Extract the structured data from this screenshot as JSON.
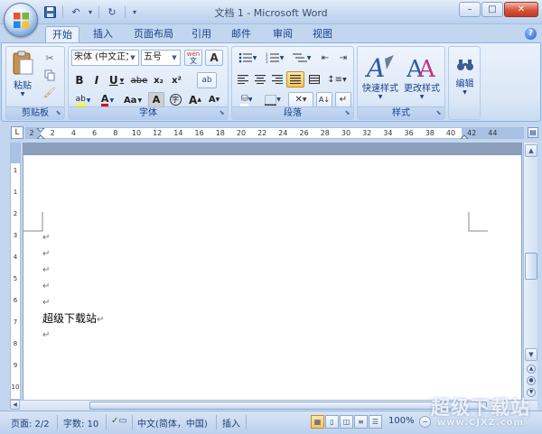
{
  "window": {
    "title": "文档 1 - Microsoft Word",
    "min_glyph": "–",
    "max_glyph": "□",
    "close_glyph": "✕"
  },
  "qat": {
    "undo_glyph": "↶",
    "redo_glyph": "↻",
    "dropdown_glyph": "▾"
  },
  "tabs": [
    {
      "label": "开始",
      "active": true
    },
    {
      "label": "插入"
    },
    {
      "label": "页面布局"
    },
    {
      "label": "引用"
    },
    {
      "label": "邮件"
    },
    {
      "label": "审阅"
    },
    {
      "label": "视图"
    }
  ],
  "help_glyph": "?",
  "ribbon": {
    "clipboard": {
      "label": "剪贴板",
      "paste_label": "粘贴"
    },
    "font": {
      "label": "字体",
      "font_name": "宋体 (中文正文)",
      "font_size": "五号",
      "wen_glyph": "wén",
      "bold": "B",
      "italic": "I",
      "underline": "U",
      "strike": "abe",
      "subscript": "x₂",
      "superscript": "x²",
      "aa": "Aa",
      "a_box": "A",
      "a_circle": "字",
      "grow": "A",
      "shrink": "A"
    },
    "paragraph": {
      "label": "段落"
    },
    "styles": {
      "label": "样式",
      "quick_styles": "快速样式",
      "change_styles": "更改样式"
    },
    "editing": {
      "label": "编辑"
    }
  },
  "ruler": {
    "corner_glyph": "L",
    "ticks": [
      "2",
      "2",
      "4",
      "6",
      "8",
      "10",
      "12",
      "14",
      "16",
      "18",
      "20",
      "22",
      "24",
      "26",
      "28",
      "30",
      "32",
      "34",
      "36",
      "38",
      "40",
      "42",
      "44"
    ],
    "vticks": [
      "1",
      "1",
      "2",
      "3",
      "4",
      "5",
      "6",
      "7",
      "8",
      "9",
      "10"
    ]
  },
  "document": {
    "para_mark": "↵",
    "text": "超级下载站"
  },
  "status": {
    "page": "页面: 2/2",
    "words": "字数: 10",
    "language": "中文(简体，中国)",
    "mode": "插入",
    "zoom": "100%",
    "zoom_minus": "−"
  },
  "watermark": {
    "big": "超级下载站",
    "small": "www.CJXZ.com"
  },
  "colors": {
    "accent": "#15428b",
    "ribbon_bg": "#dbe7f6",
    "highlight": "#f8c55a"
  }
}
